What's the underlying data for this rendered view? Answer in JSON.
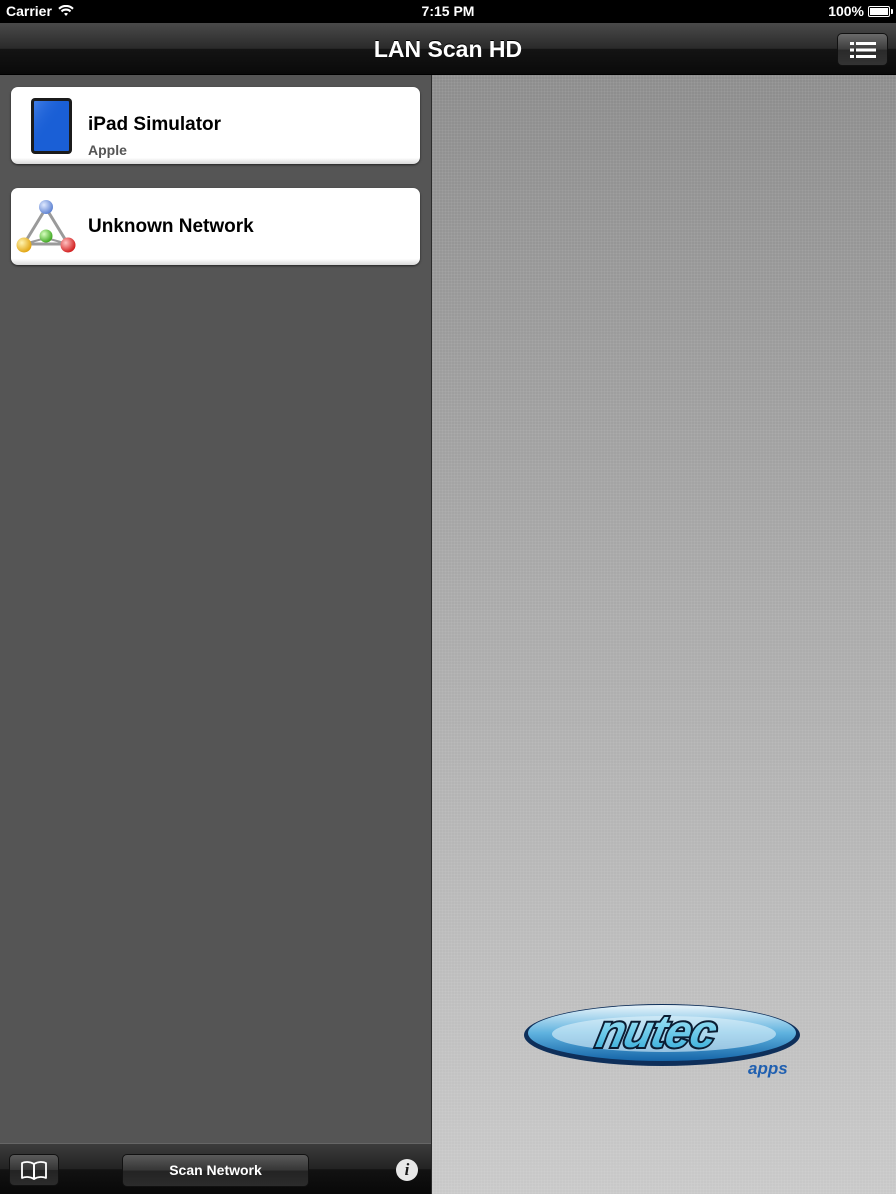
{
  "status_bar": {
    "carrier": "Carrier",
    "time": "7:15 PM",
    "battery": "100%"
  },
  "nav_bar": {
    "title": "LAN Scan HD",
    "menu_icon": "list-icon"
  },
  "devices": [
    {
      "title": "iPad Simulator",
      "subtitle": "Apple",
      "icon": "ipad-icon"
    },
    {
      "title": "Unknown Network",
      "subtitle": "",
      "icon": "network-icon"
    }
  ],
  "toolbar": {
    "bookmarks_icon": "book-icon",
    "scan_label": "Scan Network",
    "info_icon": "info-icon",
    "info_glyph": "i"
  },
  "logo": {
    "brand": "nutec",
    "tagline": "apps"
  },
  "colors": {
    "left_pane": "#555555",
    "ipad_screen": "#1a5fd6"
  }
}
